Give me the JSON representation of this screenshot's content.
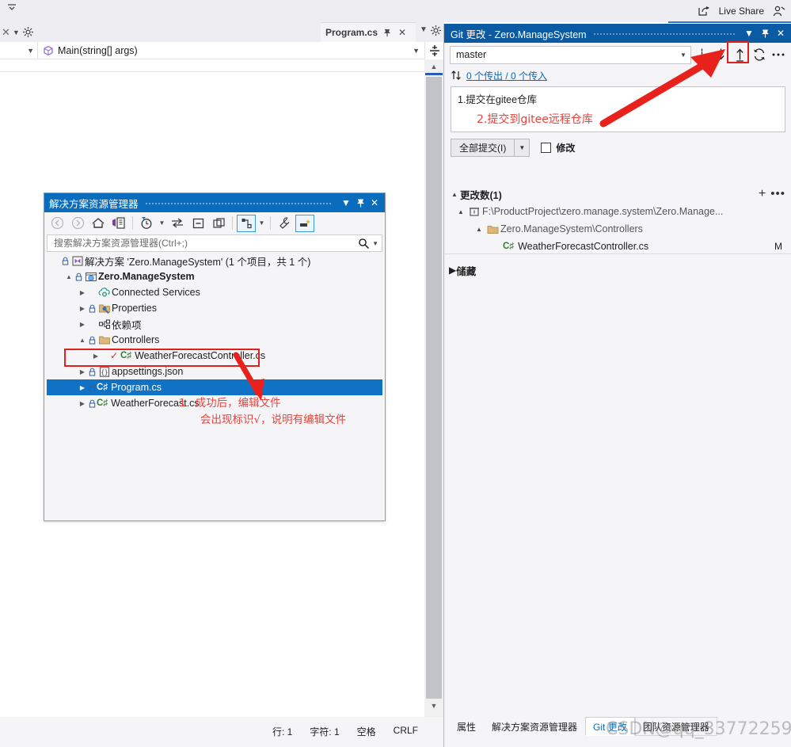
{
  "app": {
    "live_share_label": "Live Share"
  },
  "editor": {
    "tab_label": "Program.cs",
    "member_dropdown": "Main(string[] args)",
    "tab_pin_icon": "pin-icon",
    "tab_close_icon": "close-icon"
  },
  "status_bar": {
    "line": "行: 1",
    "char": "字符: 1",
    "spaces": "空格",
    "eol": "CRLF"
  },
  "solution_explorer": {
    "title": "解决方案资源管理器",
    "search_placeholder": "搜索解决方案资源管理器(Ctrl+;)",
    "toolbar": [
      {
        "name": "back-icon"
      },
      {
        "name": "forward-icon"
      },
      {
        "name": "home-icon"
      },
      {
        "name": "sync-with-active-document-icon"
      },
      {
        "name": "pending-changes-icon"
      },
      {
        "name": "switch-views-icon"
      },
      {
        "name": "collapse-all-icon"
      },
      {
        "name": "properties-window-icon"
      },
      {
        "name": "show-all-files-icon"
      },
      {
        "name": "properties-icon"
      },
      {
        "name": "preview-selected-items-icon"
      }
    ],
    "tree": [
      {
        "label": "解决方案 'Zero.ManageSystem' (1 个项目，共 1 个)",
        "indent": 0,
        "expander": "",
        "icon": "solution-icon",
        "lock": true,
        "bold": false,
        "selected": false
      },
      {
        "label": "Zero.ManageSystem",
        "indent": 1,
        "expander": "▲",
        "icon": "project-web-icon",
        "lock": true,
        "bold": true,
        "selected": false
      },
      {
        "label": "Connected Services",
        "indent": 2,
        "expander": "▶",
        "icon": "connected-services-icon",
        "lock": false,
        "bold": false,
        "selected": false
      },
      {
        "label": "Properties",
        "indent": 2,
        "expander": "▶",
        "icon": "properties-folder-icon",
        "lock": true,
        "bold": false,
        "selected": false
      },
      {
        "label": "依赖项",
        "indent": 2,
        "expander": "▶",
        "icon": "dependencies-icon",
        "lock": false,
        "bold": false,
        "selected": false
      },
      {
        "label": "Controllers",
        "indent": 2,
        "expander": "▲",
        "icon": "folder-icon",
        "lock": true,
        "bold": false,
        "selected": false
      },
      {
        "label": "WeatherForecastController.cs",
        "indent": 3,
        "expander": "▶",
        "icon": "csharp-icon",
        "lock": false,
        "check": true,
        "bold": false,
        "selected": false
      },
      {
        "label": "appsettings.json",
        "indent": 2,
        "expander": "▶",
        "icon": "json-icon",
        "lock": true,
        "bold": false,
        "selected": false
      },
      {
        "label": "Program.cs",
        "indent": 2,
        "expander": "▶",
        "icon": "csharp-icon",
        "lock": true,
        "bold": false,
        "selected": true
      },
      {
        "label": "WeatherForecast.cs",
        "indent": 2,
        "expander": "▶",
        "icon": "csharp-icon",
        "lock": true,
        "bold": false,
        "selected": false
      }
    ],
    "annotation": {
      "number": "1",
      "line1": "成功后，编辑文件",
      "line2": "会出现标识√，说明有编辑文件",
      "color": "#e8433c"
    }
  },
  "git_changes": {
    "title": "Git 更改 - Zero.ManageSystem",
    "branch": "master",
    "outgoing_incoming": "0 个传出 / 0 个传入",
    "commit_message_line1": "1.提交在gitee仓库",
    "commit_message_line2": "2.提交到gitee远程仓库",
    "commit_all_label": "全部提交(I)",
    "amend_label": "修改",
    "amend_checked": false,
    "changes_section_title": "更改数(1)",
    "repo_path": "F:\\ProductProject\\zero.manage.system\\Zero.Manage...",
    "folder_path": "Zero.ManageSystem\\Controllers",
    "changed_file": "WeatherForecastController.cs",
    "changed_file_status": "M",
    "stash_section_title": "储藏",
    "actions": [
      {
        "name": "fetch-icon"
      },
      {
        "name": "pull-icon"
      },
      {
        "name": "push-icon",
        "highlighted": true
      },
      {
        "name": "sync-icon"
      },
      {
        "name": "more-options-icon"
      }
    ],
    "bottom_tabs": [
      {
        "label": "属性",
        "active": false,
        "framed": false
      },
      {
        "label": "解决方案资源管理器",
        "active": false,
        "framed": false
      },
      {
        "label": "Git 更改",
        "active": true,
        "framed": false
      },
      {
        "label": "团队资源管理器",
        "active": false,
        "framed": true
      }
    ]
  },
  "watermark": "CSDN@qq_33772259",
  "colors": {
    "se_title_bg": "#0a6cbc",
    "git_title_bg": "#0a5ba3",
    "selection_blue": "#0f72c4",
    "annotation_red": "#e8433c",
    "highlight_red": "#e01f1f",
    "link_blue": "#1167b1"
  }
}
